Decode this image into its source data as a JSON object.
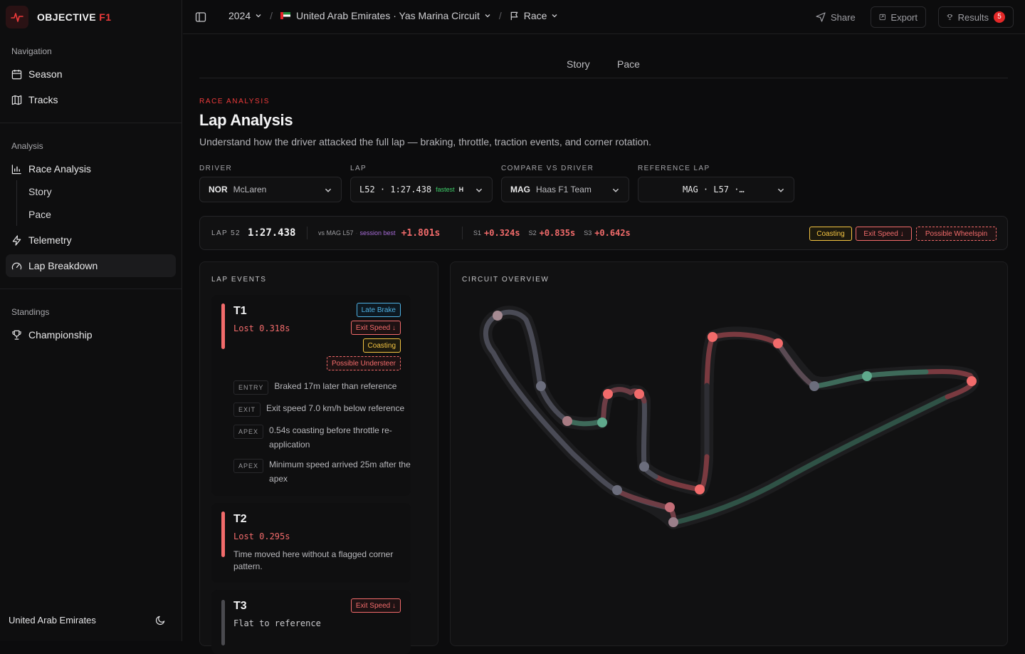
{
  "app": {
    "brand_main": "OBJECTIVE",
    "brand_accent": "F1"
  },
  "sidebar": {
    "nav_label": "Navigation",
    "nav_items": [
      {
        "label": "Season",
        "icon": "calendar-icon"
      },
      {
        "label": "Tracks",
        "icon": "map-icon"
      }
    ],
    "analysis_label": "Analysis",
    "race_analysis": "Race Analysis",
    "race_sub": [
      "Story",
      "Pace"
    ],
    "telemetry": "Telemetry",
    "lap_breakdown": "Lap Breakdown",
    "standings_label": "Standings",
    "championship": "Championship",
    "footer_country": "United Arab Emirates"
  },
  "topbar": {
    "year": "2024",
    "event": "United Arab Emirates · Yas Marina Circuit",
    "session": "Race",
    "share": "Share",
    "export": "Export",
    "results": "Results",
    "results_count": "5"
  },
  "tabs": [
    "Story",
    "Pace"
  ],
  "header": {
    "eyebrow": "RACE ANALYSIS",
    "title": "Lap Analysis",
    "subtitle": "Understand how the driver attacked the full lap — braking, throttle, traction events, and corner rotation."
  },
  "filters": {
    "driver_label": "DRIVER",
    "driver_code": "NOR",
    "driver_team": "McLaren",
    "lap_label": "LAP",
    "lap_value": "L52 · 1:27.438",
    "lap_fastest": "fastest",
    "lap_flag": "H",
    "compare_label": "COMPARE VS DRIVER",
    "compare_code": "MAG",
    "compare_team": "Haas F1 Team",
    "ref_label": "REFERENCE LAP",
    "ref_value": "MAG · L57 ·…"
  },
  "lapbar": {
    "lap_label": "LAP 52",
    "lap_time": "1:27.438",
    "vs_label": "vs MAG L57",
    "session_best": "session best",
    "delta": "+1.801s",
    "s1_label": "S1",
    "s1": "+0.324s",
    "s2_label": "S2",
    "s2": "+0.835s",
    "s3_label": "S3",
    "s3": "+0.642s",
    "tags": [
      "Coasting",
      "Exit Speed ↓",
      "Possible Wheelspin"
    ]
  },
  "lap_events": {
    "title": "LAP EVENTS",
    "events": [
      {
        "name": "T1",
        "lost": "Lost 0.318s",
        "tags": [
          "Late Brake",
          "Exit Speed ↓",
          "Coasting",
          "Possible Understeer"
        ],
        "notes": [
          {
            "key": "ENTRY",
            "text": "Braked 17m later than reference"
          },
          {
            "key": "EXIT",
            "text": "Exit speed 7.0 km/h below reference"
          },
          {
            "key": "APEX",
            "text": "0.54s coasting before throttle re-application"
          },
          {
            "key": "APEX",
            "text": "Minimum speed arrived 25m after the apex"
          }
        ]
      },
      {
        "name": "T2",
        "lost": "Lost 0.295s",
        "text": "Time moved here without a flagged corner pattern."
      },
      {
        "name": "T3",
        "lost": "Flat to reference",
        "tags": [
          "Exit Speed ↓"
        ]
      }
    ]
  },
  "circuit": {
    "title": "CIRCUIT OVERVIEW"
  },
  "colors": {
    "accent": "#ef3b3b",
    "loss": "#f26b6b",
    "gain": "#5fa98c",
    "neutral": "#6d6f7e",
    "coasting": "#f5c542",
    "late_brake": "#4fb3e6"
  }
}
